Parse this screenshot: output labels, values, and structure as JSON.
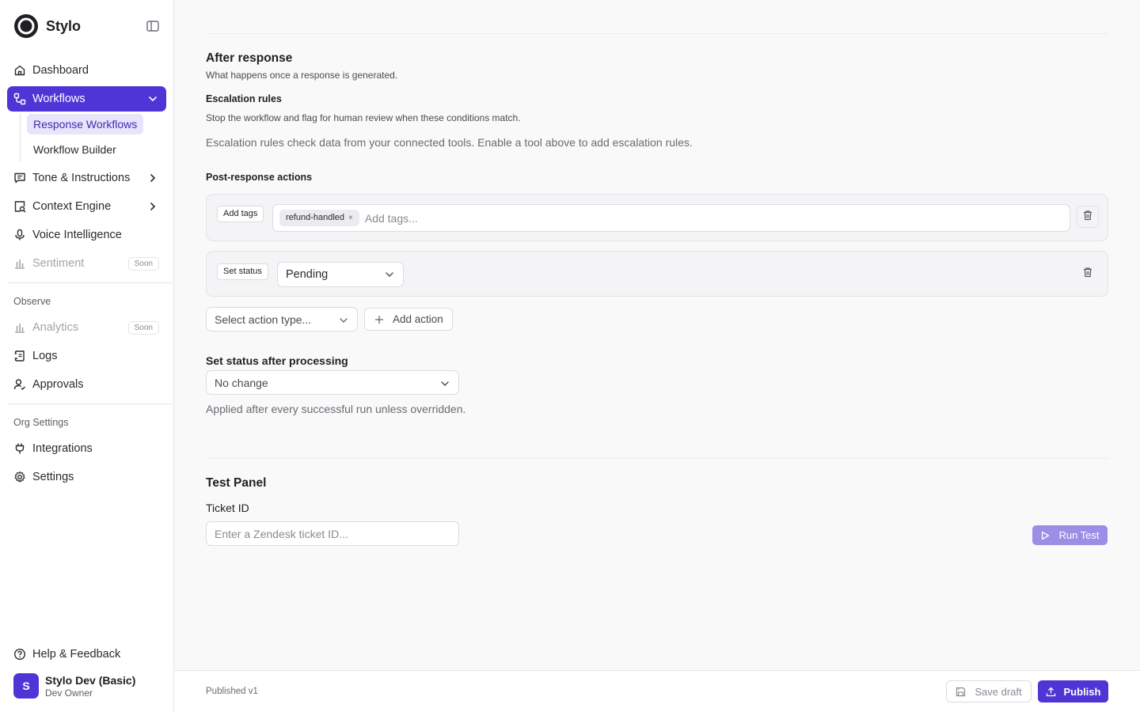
{
  "app": {
    "name": "Stylo"
  },
  "sidebar": {
    "collapse_icon": "sidebar-toggle-icon",
    "items": [
      {
        "label": "Dashboard",
        "icon": "home-icon"
      },
      {
        "label": "Workflows",
        "icon": "workflow-icon",
        "active": true
      },
      {
        "label": "Tone & Instructions",
        "icon": "message-square-icon"
      },
      {
        "label": "Context Engine",
        "icon": "search-doc-icon"
      },
      {
        "label": "Voice Intelligence",
        "icon": "mic-icon"
      },
      {
        "label": "Sentiment",
        "icon": "bar-chart-icon",
        "badge": "Soon",
        "disabled": true
      }
    ],
    "workflow_sub_items": [
      {
        "label": "Response Workflows",
        "active": true
      },
      {
        "label": "Workflow Builder"
      }
    ],
    "observe": {
      "heading": "Observe",
      "items": [
        {
          "label": "Analytics",
          "badge": "Soon",
          "disabled": true
        },
        {
          "label": "Logs"
        },
        {
          "label": "Approvals"
        }
      ]
    },
    "org_settings": {
      "heading": "Org Settings",
      "items": [
        {
          "label": "Integrations"
        },
        {
          "label": "Settings"
        }
      ]
    },
    "help_label": "Help & Feedback",
    "user": {
      "initial": "S",
      "name": "Stylo Dev (Basic)",
      "role": "Dev Owner"
    }
  },
  "after_response": {
    "title": "After response",
    "subtitle": "What happens once a response is generated.",
    "escalation": {
      "title": "Escalation rules",
      "description": "Stop the workflow and flag for human review when these conditions match.",
      "hint": "Escalation rules check data from your connected tools. Enable a tool above to add escalation rules."
    },
    "post_actions": {
      "title": "Post-response actions",
      "add_tags": {
        "label": "Add tags",
        "tags": [
          "refund-handled"
        ],
        "tag_remove": "×",
        "placeholder": "Add tags..."
      },
      "set_status": {
        "label": "Set status",
        "value": "Pending"
      },
      "action_select_placeholder": "Select action type...",
      "add_action_label": "Add action"
    },
    "status_after": {
      "label": "Set status after processing",
      "value": "No change",
      "hint": "Applied after every successful run unless overridden."
    }
  },
  "test_panel": {
    "title": "Test Panel",
    "ticket_label": "Ticket ID",
    "ticket_placeholder": "Enter a Zendesk ticket ID...",
    "run_label": "Run Test"
  },
  "footer": {
    "status": "Published v1",
    "save_label": "Save draft",
    "publish_label": "Publish"
  },
  "colors": {
    "accent": "#4f35d6",
    "accent_soft": "#e9e4fb",
    "run_disabled": "#9c8ee6"
  }
}
